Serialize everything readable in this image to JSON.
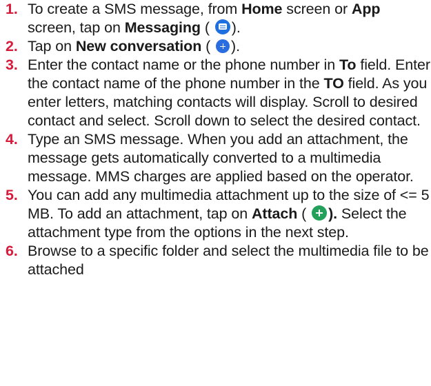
{
  "steps": [
    {
      "num": "1.",
      "pre": "To create a SMS message, from ",
      "b1": "Home",
      "mid1": " screen or ",
      "b2": "App",
      "mid2": " screen, tap on ",
      "b3": "Messaging",
      "open": " (",
      "icon": "messaging-app-icon",
      "close": ")."
    },
    {
      "num": "2.",
      "pre": "Tap on ",
      "b1": "New conversation",
      "open": " (",
      "icon": "new-conversation-icon",
      "close": ")."
    },
    {
      "num": "3.",
      "pre": "Enter the contact name or the phone number in ",
      "b1": "To",
      "mid1": " field. Enter the contact name of the phone number in the ",
      "b2": "TO",
      "post": " field.  As you enter letters, matching contacts will display. Scroll to desired contact and select. Scroll down to select the desired contact."
    },
    {
      "num": "4.",
      "text": "Type an SMS message. When you add an attachment, the message gets automatically converted to a multimedia message. MMS charges are applied based on the operator."
    },
    {
      "num": "5.",
      "pre": "You can add any multimedia attachment up to the size of <= 5 MB. To add an attachment, tap on ",
      "b1": "Attach",
      "open": " (",
      "icon": "attach-icon",
      "close": ").",
      "post": " Select the attachment type from the options in the next step."
    },
    {
      "num": "6.",
      "text": "Browse to a specific folder and select the multimedia file to be attached"
    }
  ],
  "colors": {
    "number": "#d81b3c",
    "text": "#1a1a1a",
    "messaging_icon": "#1e6fe0",
    "new_conversation_icon": "#2a6de0",
    "attach_icon": "#25a05a"
  }
}
